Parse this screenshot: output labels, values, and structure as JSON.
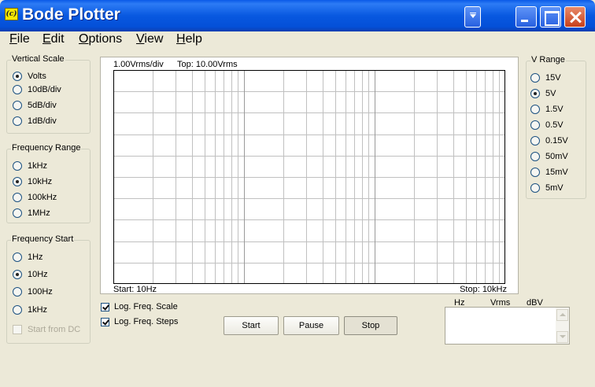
{
  "window": {
    "title": "Bode Plotter",
    "icon_label": "(c)"
  },
  "menu": [
    {
      "label": "File"
    },
    {
      "label": "Edit"
    },
    {
      "label": "Options"
    },
    {
      "label": "View"
    },
    {
      "label": "Help"
    }
  ],
  "vertical_scale": {
    "title": "Vertical Scale",
    "options": [
      "Volts",
      "10dB/div",
      "5dB/div",
      "1dB/div"
    ],
    "selected": "Volts"
  },
  "frequency_range": {
    "title": "Frequency Range",
    "options": [
      "1kHz",
      "10kHz",
      "100kHz",
      "1MHz"
    ],
    "selected": "10kHz"
  },
  "frequency_start": {
    "title": "Frequency Start",
    "options": [
      "1Hz",
      "10Hz",
      "100Hz",
      "1kHz"
    ],
    "selected": "10Hz",
    "start_from_dc": "Start from DC"
  },
  "v_range": {
    "title": "V Range",
    "options": [
      "15V",
      "5V",
      "1.5V",
      "0.5V",
      "0.15V",
      "50mV",
      "15mV",
      "5mV"
    ],
    "selected": "5V"
  },
  "plot": {
    "scale_label": "1.00Vrms/div",
    "top_label": "Top: 10.00Vrms",
    "start_label": "Start: 10Hz",
    "stop_label": "Stop: 10kHz",
    "vertical_divisions": 10,
    "log_start_hz": 10,
    "log_stop_hz": 10000
  },
  "checkboxes": {
    "log_freq_scale": "Log. Freq. Scale",
    "log_freq_steps": "Log. Freq. Steps"
  },
  "buttons": {
    "start": "Start",
    "pause": "Pause",
    "stop": "Stop"
  },
  "readout": {
    "hz": "Hz",
    "vrms": "Vrms",
    "dbv": "dBV"
  },
  "colors": {
    "titlebar": "#0858e0",
    "face": "#ece9d8",
    "grid": "#c0c0c0"
  }
}
